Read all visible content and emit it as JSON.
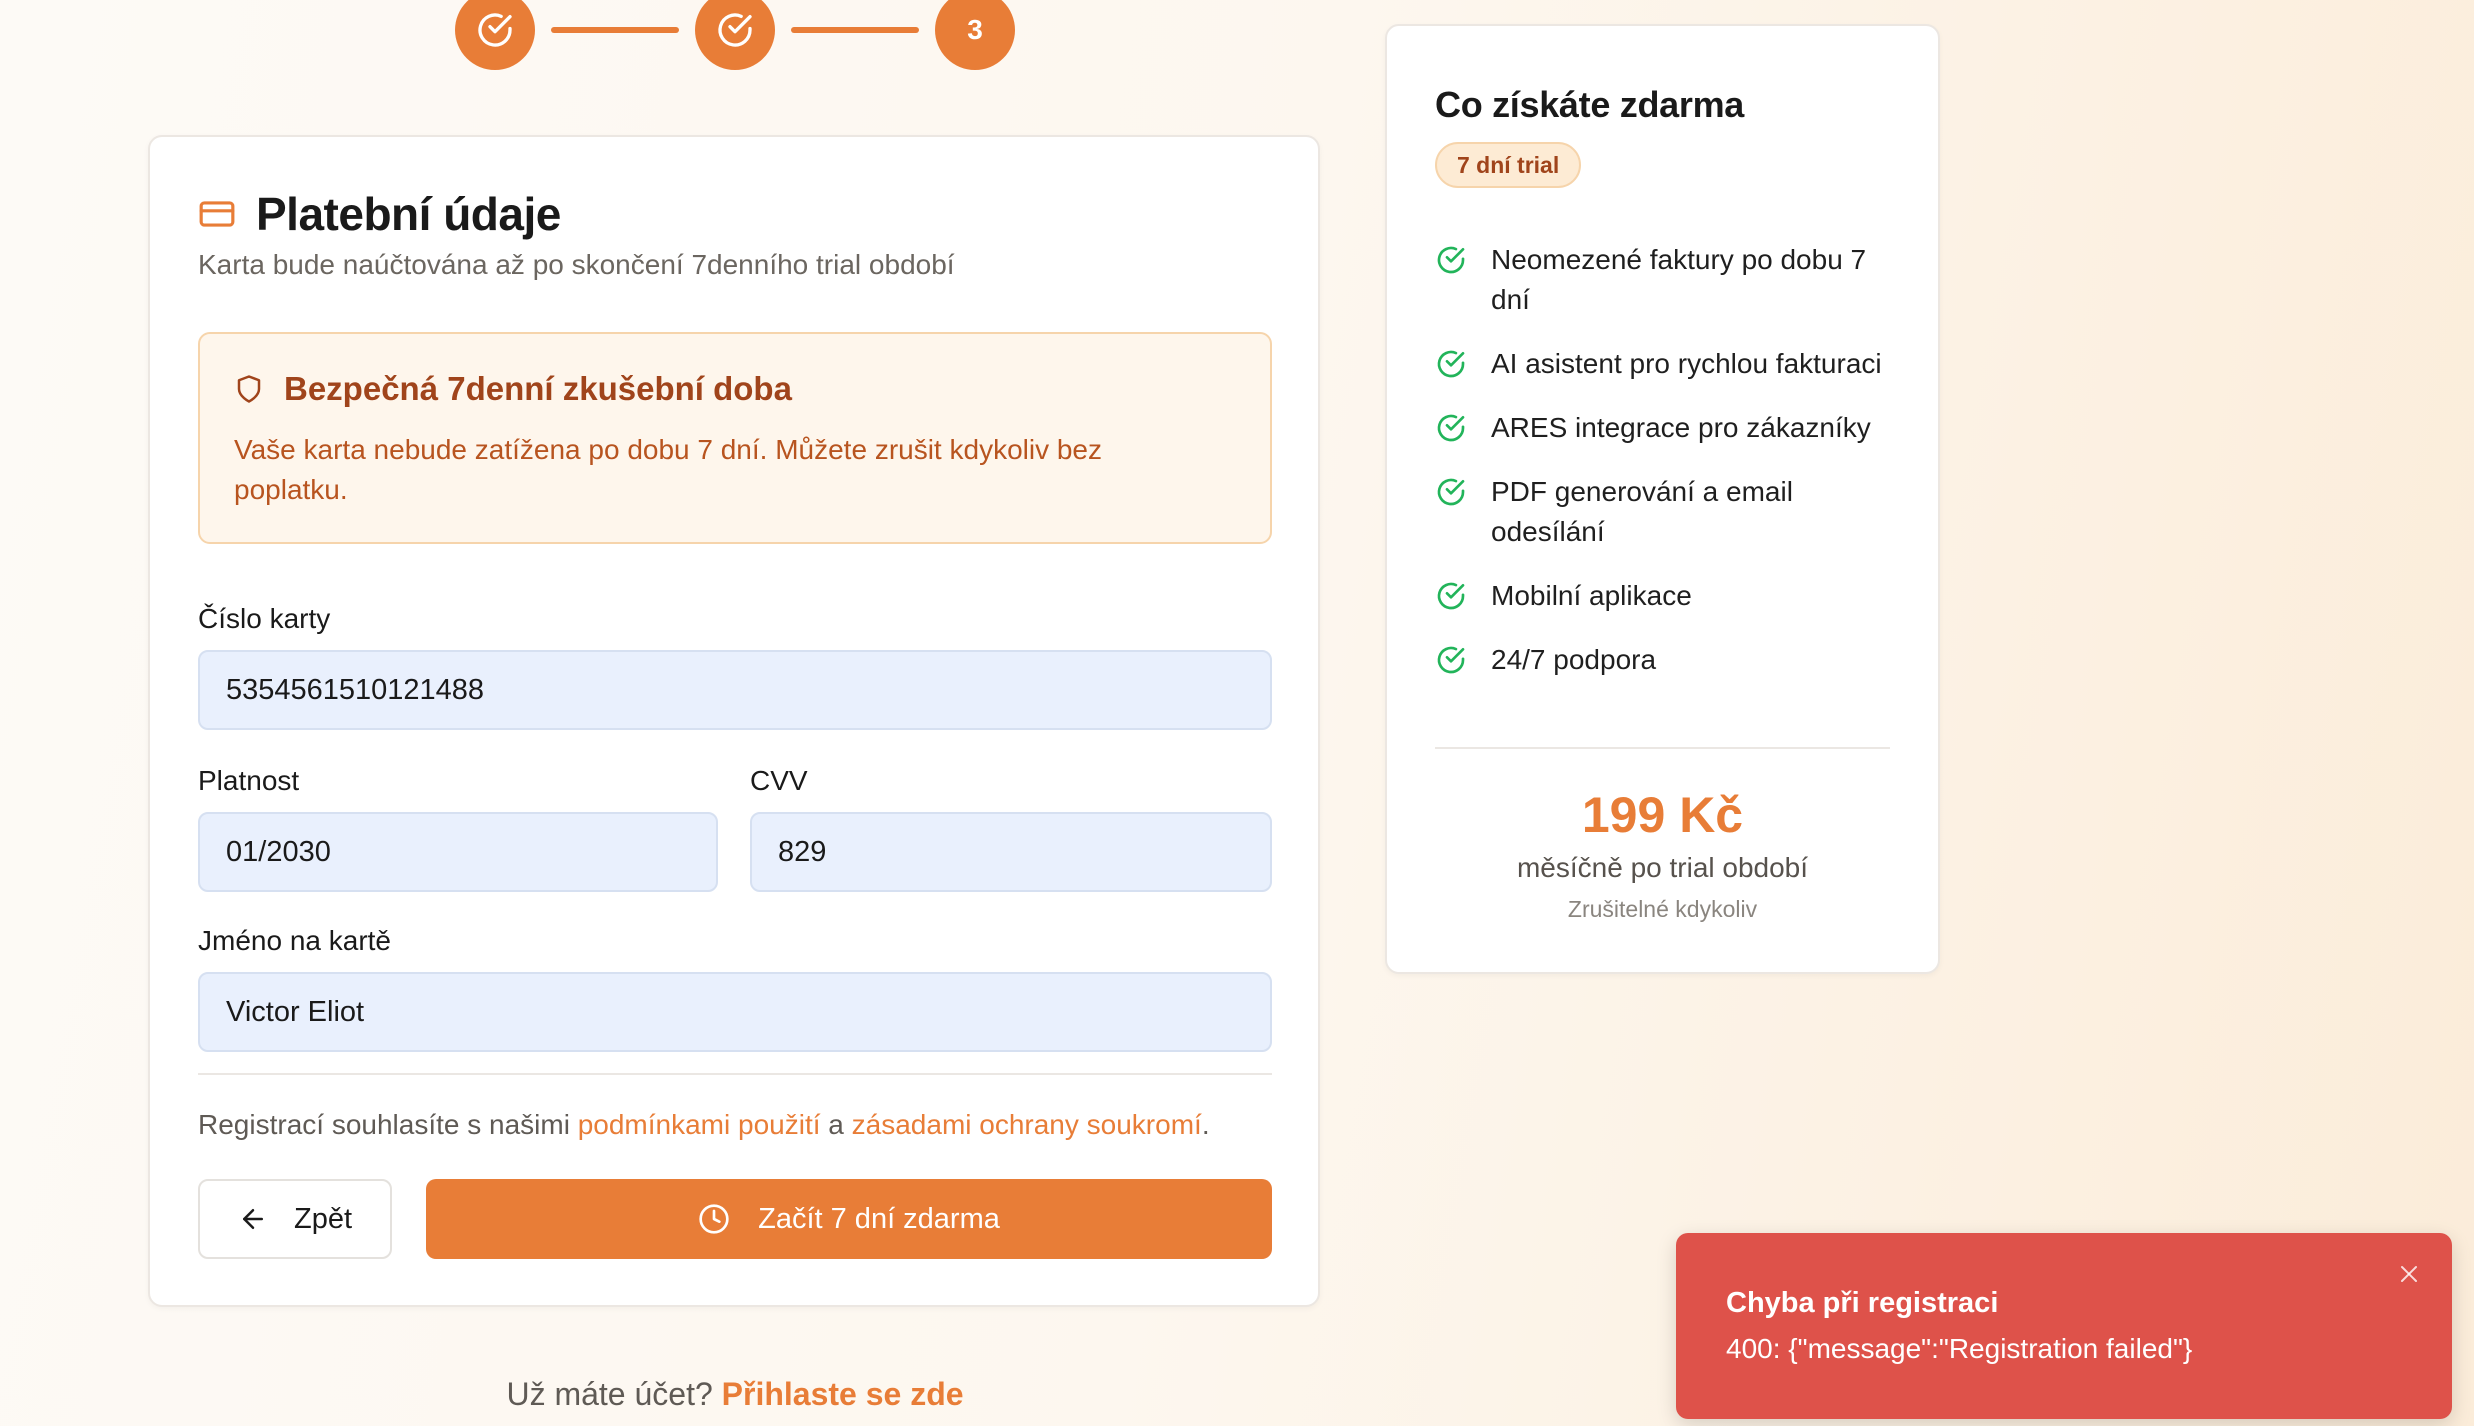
{
  "stepper": {
    "steps": [
      {
        "state": "completed",
        "icon": "check-circle-icon"
      },
      {
        "state": "completed",
        "icon": "check-circle-icon"
      },
      {
        "state": "current",
        "number": "3"
      }
    ]
  },
  "payment": {
    "title": "Platební údaje",
    "title_icon": "credit-card-icon",
    "subtitle": "Karta bude naúčtována až po skončení 7denního trial období",
    "notice": {
      "icon": "shield-icon",
      "title": "Bezpečná 7denní zkušební doba",
      "text": "Vaše karta nebude zatížena po dobu 7 dní. Můžete zrušit kdykoliv bez poplatku."
    },
    "card_number": {
      "label": "Číslo karty",
      "value": "5354561510121488"
    },
    "expiry": {
      "label": "Platnost",
      "value": "01/2030"
    },
    "cvv": {
      "label": "CVV",
      "value": "829"
    },
    "name": {
      "label": "Jméno na kartě",
      "value": "Victor Eliot"
    },
    "terms": {
      "prefix": "Registrací souhlasíte s našimi ",
      "link1": "podmínkami použití",
      "middle": " a ",
      "link2": "zásadami ochrany soukromí",
      "suffix": "."
    },
    "back_label": "Zpět",
    "submit_label": "Začít 7 dní zdarma"
  },
  "login": {
    "prompt": "Už máte účet?",
    "link": "Přihlaste se zde"
  },
  "benefits": {
    "title": "Co získáte zdarma",
    "badge": "7 dní trial",
    "items": [
      "Neomezené faktury po dobu 7 dní",
      "AI asistent pro rychlou fakturaci",
      "ARES integrace pro zákazníky",
      "PDF generování a email odesílání",
      "Mobilní aplikace",
      "24/7 podpora"
    ],
    "price": "199 Kč",
    "price_period": "měsíčně po trial období",
    "price_note": "Zrušitelné kdykoliv"
  },
  "toast": {
    "title": "Chyba při registraci",
    "message": "400: {\"message\":\"Registration failed\"}"
  },
  "colors": {
    "accent": "#e87d37",
    "notice_bg": "#fef6ec",
    "notice_text": "#b8541f",
    "success": "#22b45a",
    "error": "#de524a",
    "input_bg": "#e9f0fd"
  }
}
